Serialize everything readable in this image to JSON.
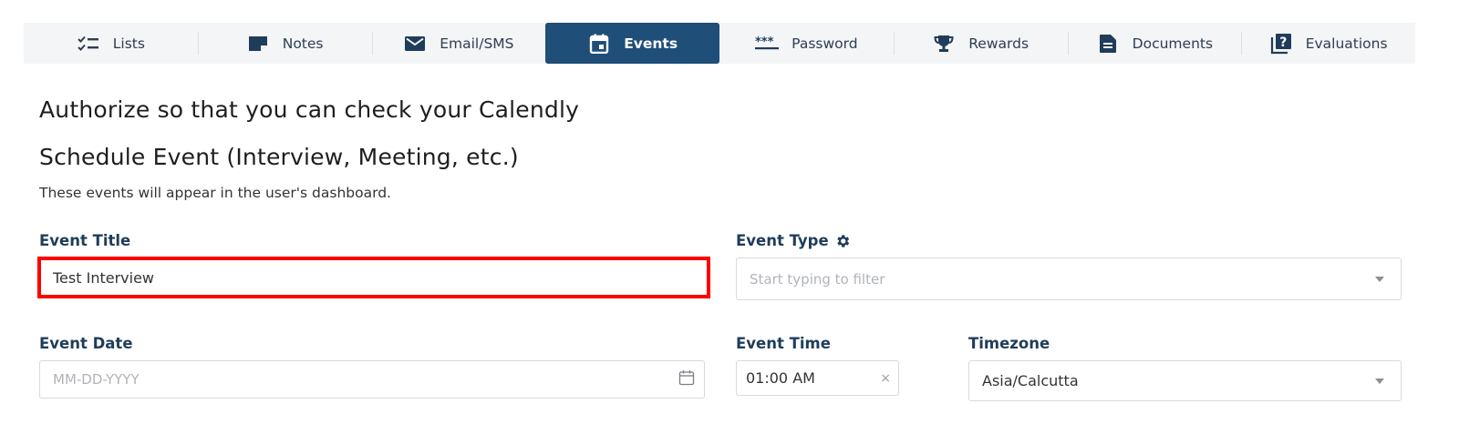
{
  "tabs": [
    {
      "label": "Lists",
      "icon": "checklist-icon",
      "active": false
    },
    {
      "label": "Notes",
      "icon": "note-icon",
      "active": false
    },
    {
      "label": "Email/SMS",
      "icon": "envelope-icon",
      "active": false
    },
    {
      "label": "Events",
      "icon": "calendar-icon",
      "active": true
    },
    {
      "label": "Password",
      "icon": "password-dots-icon",
      "active": false
    },
    {
      "label": "Rewards",
      "icon": "trophy-icon",
      "active": false
    },
    {
      "label": "Documents",
      "icon": "document-icon",
      "active": false
    },
    {
      "label": "Evaluations",
      "icon": "question-cards-icon",
      "active": false
    }
  ],
  "main": {
    "authorize_heading": "Authorize so that you can check your Calendly",
    "schedule_heading": "Schedule Event (Interview, Meeting, etc.)",
    "schedule_subtitle": "These events will appear in the user's dashboard."
  },
  "form": {
    "event_title": {
      "label": "Event Title",
      "value": "Test Interview"
    },
    "event_type": {
      "label": "Event Type",
      "placeholder": "Start typing to filter"
    },
    "event_date": {
      "label": "Event Date",
      "placeholder": "MM-DD-YYYY"
    },
    "event_time": {
      "label": "Event Time",
      "value": "01:00 AM",
      "clear": "×"
    },
    "timezone": {
      "label": "Timezone",
      "value": "Asia/Calcutta"
    }
  },
  "colors": {
    "active_tab": "#1f4e79",
    "label": "#1f3d5a",
    "highlight": "#ff0000"
  }
}
